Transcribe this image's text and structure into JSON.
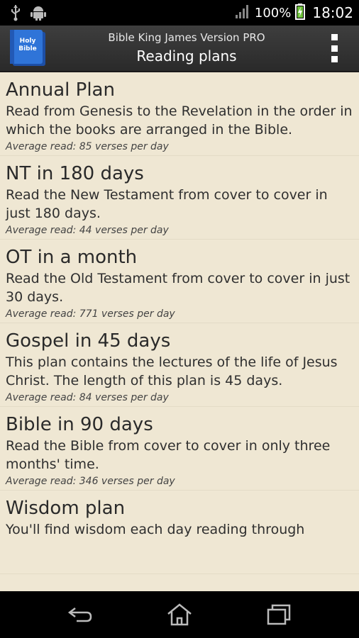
{
  "status_bar": {
    "battery": "100%",
    "time": "18:02"
  },
  "action_bar": {
    "app_icon_text_line1": "Holy",
    "app_icon_text_line2": "Bible",
    "app_title": "Bible King James Version PRO",
    "screen_title": "Reading plans"
  },
  "plans": [
    {
      "title": "Annual Plan",
      "description": "Read from Genesis to the Revelation in the order in which the books are arranged in the Bible.",
      "average": "Average read: 85 verses per day"
    },
    {
      "title": "NT in 180 days",
      "description": "Read the New Testament from cover to cover in just 180 days.",
      "average": "Average read: 44 verses per day"
    },
    {
      "title": "OT in a month",
      "description": "Read the Old Testament from cover to cover in just 30 days.",
      "average": "Average read: 771 verses per day"
    },
    {
      "title": "Gospel in 45 days",
      "description": "This plan contains the lectures of the life of Jesus Christ. The length of this plan is 45 days.",
      "average": "Average read: 84 verses per day"
    },
    {
      "title": "Bible in 90 days",
      "description": "Read the Bible from cover to cover in only three months' time.",
      "average": "Average read: 346 verses per day"
    },
    {
      "title": "Wisdom plan",
      "description": "You'll find wisdom each day reading through",
      "average": ""
    }
  ]
}
